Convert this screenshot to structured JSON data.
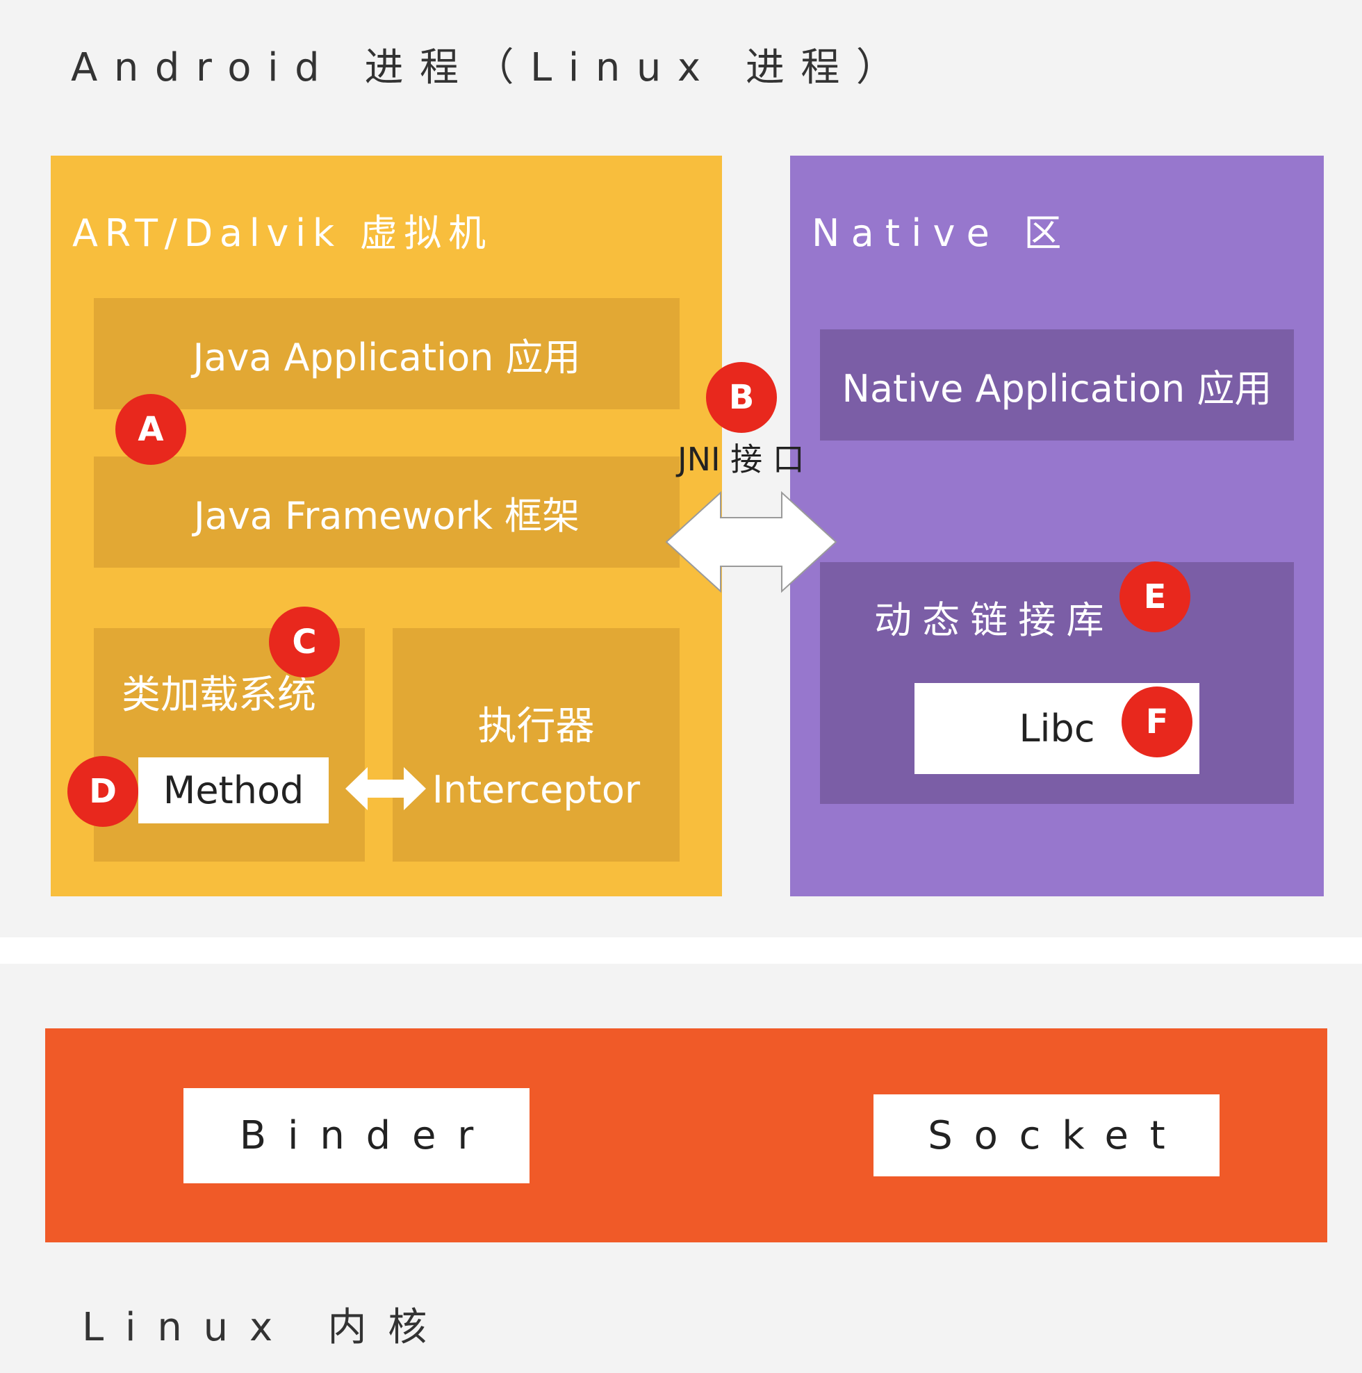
{
  "process": {
    "title": "Android 进程（Linux 进程）"
  },
  "art_vm": {
    "title": "ART/Dalvik 虚拟机",
    "java_application": "Java Application 应用",
    "java_framework": "Java Framework 框架",
    "class_loader": "类加载系统",
    "method": "Method",
    "executor": "执行器",
    "interceptor": "Interceptor"
  },
  "native_area": {
    "title": "Native 区",
    "native_application": "Native Application 应用",
    "dynamic_library": "动态链接库",
    "libc": "Libc"
  },
  "jni": {
    "label": "JNI 接 口"
  },
  "kernel": {
    "title": "Linux 内核",
    "binder": "Binder",
    "socket": "Socket"
  },
  "badges": {
    "a": "A",
    "b": "B",
    "c": "C",
    "d": "D",
    "e": "E",
    "f": "F"
  },
  "colors": {
    "background": "#f3f3f3",
    "art_box": "#f8be3d",
    "art_inner": "#e2a834",
    "native_box": "#9777cd",
    "native_inner": "#7b5ea6",
    "kernel_box": "#f05a28",
    "badge": "#e8281d"
  }
}
